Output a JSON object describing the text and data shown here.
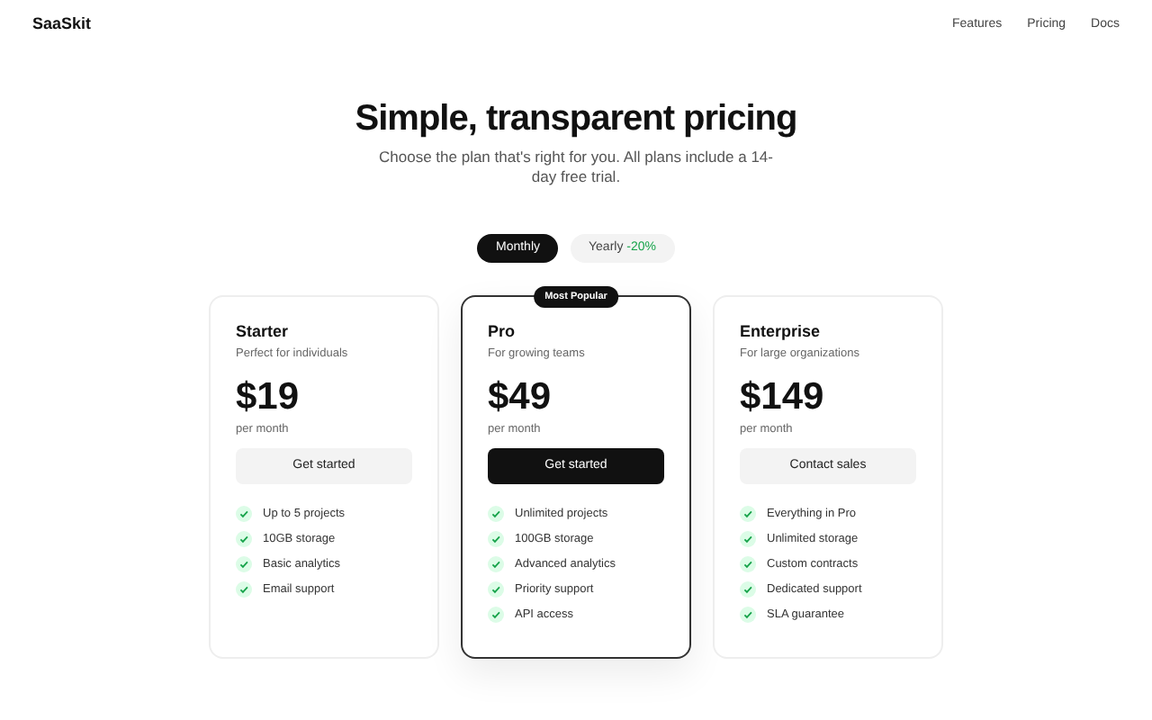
{
  "brand": "SaaSkit",
  "nav": [
    {
      "label": "Features"
    },
    {
      "label": "Pricing"
    },
    {
      "label": "Docs"
    }
  ],
  "hero": {
    "title": "Simple, transparent pricing",
    "subtitle": "Choose the plan that's right for you. All plans include a 14-day free trial."
  },
  "billing_toggle": [
    {
      "label": "Monthly",
      "selected": true
    },
    {
      "label": "Yearly",
      "discount": "-20%",
      "selected": false
    }
  ],
  "plans": [
    {
      "name": "Starter",
      "tagline": "Perfect for individuals",
      "price": "$19",
      "period": "per month",
      "button": "Get started",
      "featured": false,
      "features": [
        "Up to 5 projects",
        "10GB storage",
        "Basic analytics",
        "Email support"
      ]
    },
    {
      "name": "Pro",
      "tagline": "For growing teams",
      "price": "$49",
      "period": "per month",
      "button": "Get started",
      "featured": true,
      "badge": "Most Popular",
      "features": [
        "Unlimited projects",
        "100GB storage",
        "Advanced analytics",
        "Priority support",
        "API access"
      ]
    },
    {
      "name": "Enterprise",
      "tagline": "For large organizations",
      "price": "$149",
      "period": "per month",
      "button": "Contact sales",
      "featured": false,
      "features": [
        "Everything in Pro",
        "Unlimited storage",
        "Custom contracts",
        "Dedicated support",
        "SLA guarantee"
      ]
    }
  ]
}
